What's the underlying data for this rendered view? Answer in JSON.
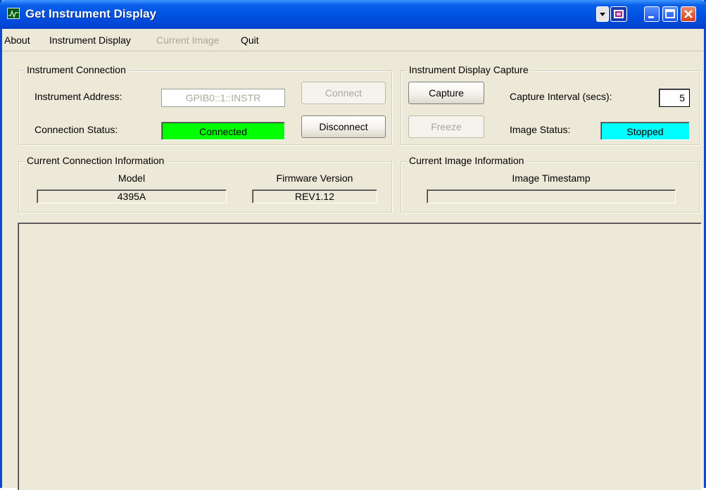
{
  "window": {
    "title": "Get Instrument Display",
    "controls": [
      "menu-icon",
      "extra-icon",
      "minimize-icon",
      "maximize-icon",
      "close-icon"
    ]
  },
  "menu": {
    "about": "About",
    "instrument_display": "Instrument Display",
    "current_image": "Current Image",
    "quit": "Quit"
  },
  "connection": {
    "group_title": "Instrument Connection",
    "address_label": "Instrument Address:",
    "address_value": "GPIB0::1::INSTR",
    "status_label": "Connection Status:",
    "status_value": "Connected",
    "connect_button": "Connect",
    "disconnect_button": "Disconnect"
  },
  "capture": {
    "group_title": "Instrument Display Capture",
    "capture_button": "Capture",
    "freeze_button": "Freeze",
    "interval_label": "Capture Interval (secs):",
    "interval_value": "5",
    "image_status_label": "Image Status:",
    "image_status_value": "Stopped"
  },
  "connection_info": {
    "group_title": "Current Connection Information",
    "model_label": "Model",
    "model_value": "4395A",
    "firmware_label": "Firmware Version",
    "firmware_value": "REV1.12"
  },
  "image_info": {
    "group_title": "Current Image Information",
    "timestamp_label": "Image Timestamp",
    "timestamp_value": ""
  },
  "colors": {
    "titlebar": "#0054e3",
    "status_connected": "#00ff00",
    "status_stopped": "#00ffff",
    "background": "#ece9d8"
  }
}
